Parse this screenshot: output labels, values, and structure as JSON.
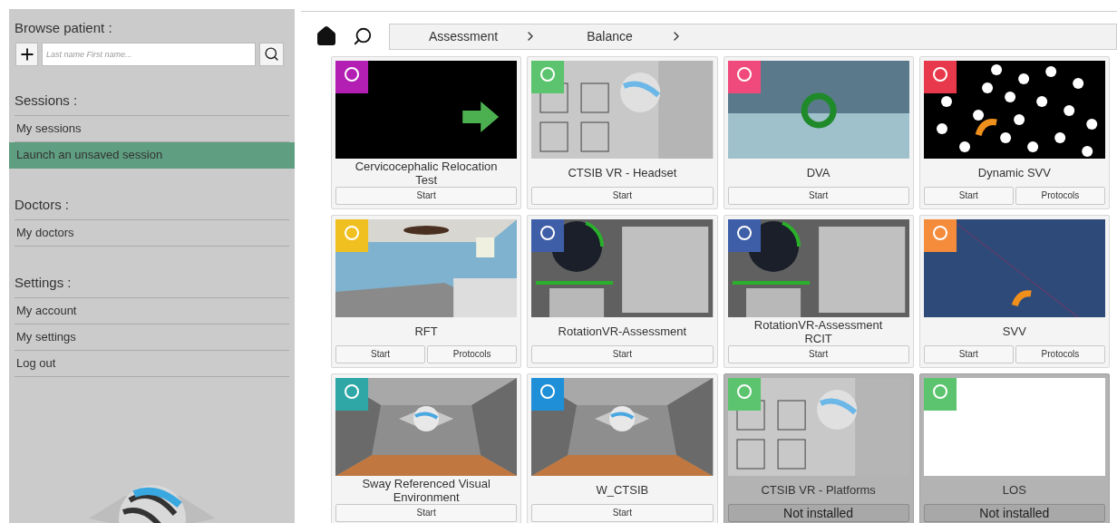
{
  "sidebar": {
    "browse": {
      "title": "Browse patient :",
      "search": {
        "placeholder": "Last name First name..."
      }
    },
    "sections": [
      {
        "title": "Sessions :",
        "items": [
          {
            "label": "My sessions",
            "selected": false
          },
          {
            "label": "Launch an unsaved session",
            "selected": true
          }
        ]
      },
      {
        "title": "Doctors :",
        "items": [
          {
            "label": "My doctors",
            "selected": false
          }
        ]
      },
      {
        "title": "Settings :",
        "items": [
          {
            "label": "My account",
            "selected": false
          },
          {
            "label": "My settings",
            "selected": false
          },
          {
            "label": "Log out",
            "selected": false
          }
        ]
      }
    ]
  },
  "breadcrumb": [
    {
      "label": "Assessment"
    },
    {
      "label": "Balance"
    }
  ],
  "cards": [
    {
      "title": "Cervicocephalic Relocation Test",
      "installed": true,
      "buttons": [
        "Start"
      ]
    },
    {
      "title": "CTSIB VR - Headset",
      "installed": true,
      "buttons": [
        "Start"
      ]
    },
    {
      "title": "DVA",
      "installed": true,
      "buttons": [
        "Start"
      ]
    },
    {
      "title": "Dynamic SVV",
      "installed": true,
      "buttons": [
        "Start",
        "Protocols"
      ]
    },
    {
      "title": "RFT",
      "installed": true,
      "buttons": [
        "Start",
        "Protocols"
      ]
    },
    {
      "title": "RotationVR-Assessment",
      "installed": true,
      "buttons": [
        "Start"
      ]
    },
    {
      "title": "RotationVR-Assessment RCIT",
      "installed": true,
      "buttons": [
        "Start"
      ]
    },
    {
      "title": "SVV",
      "installed": true,
      "buttons": [
        "Start",
        "Protocols"
      ]
    },
    {
      "title": "Sway Referenced Visual Environment",
      "installed": true,
      "buttons": [
        "Start"
      ]
    },
    {
      "title": "W_CTSIB",
      "installed": true,
      "buttons": [
        "Start"
      ]
    },
    {
      "title": "CTSIB VR - Platforms",
      "installed": false,
      "buttons": [
        "Not installed"
      ]
    },
    {
      "title": "LOS",
      "installed": false,
      "buttons": [
        "Not installed"
      ]
    }
  ]
}
